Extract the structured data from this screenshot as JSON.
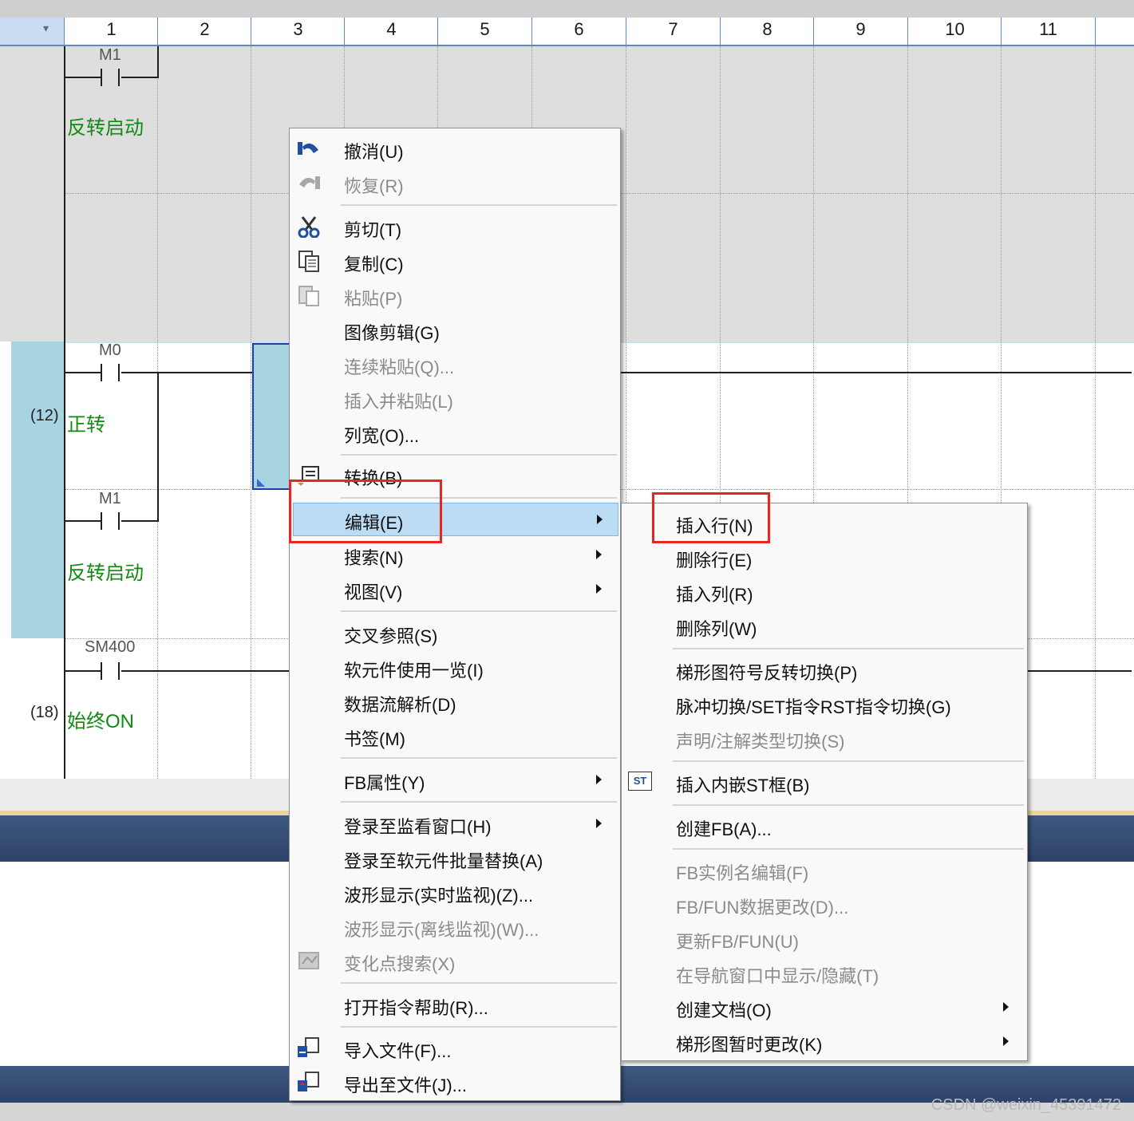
{
  "header": {
    "corner_icon": "chevron-down-icon",
    "corner_glyph": "▾",
    "columns": [
      "1",
      "2",
      "3",
      "4",
      "5",
      "6",
      "7",
      "8",
      "9",
      "10",
      "11"
    ]
  },
  "ladder": {
    "rungs": [
      {
        "step": "",
        "device": "M1",
        "comment": "反转启动"
      },
      {
        "step": "(12)",
        "device": "M0",
        "comment": "正转"
      },
      {
        "step": "",
        "device": "M1",
        "comment": "反转启动"
      },
      {
        "step": "(18)",
        "device": "SM400",
        "comment": "始终ON"
      }
    ]
  },
  "context_menu": {
    "items": [
      {
        "label": "撤消(U)",
        "icon": "undo-icon",
        "disabled": false
      },
      {
        "label": "恢复(R)",
        "icon": "redo-icon",
        "disabled": true
      },
      {
        "label": "剪切(T)",
        "icon": "scissors-icon",
        "disabled": false
      },
      {
        "label": "复制(C)",
        "icon": "copy-icon",
        "disabled": false
      },
      {
        "label": "粘贴(P)",
        "icon": "paste-icon",
        "disabled": true
      },
      {
        "label": "图像剪辑(G)",
        "disabled": false
      },
      {
        "label": "连续粘贴(Q)...",
        "disabled": true
      },
      {
        "label": "插入并粘贴(L)",
        "disabled": true
      },
      {
        "label": "列宽(O)...",
        "disabled": false
      },
      {
        "label": "转换(B)",
        "icon": "convert-icon",
        "disabled": false
      },
      {
        "label": "编辑(E)",
        "submenu": true,
        "active": true
      },
      {
        "label": "搜索(N)",
        "submenu": true
      },
      {
        "label": "视图(V)",
        "submenu": true
      },
      {
        "label": "交叉参照(S)"
      },
      {
        "label": "软元件使用一览(I)"
      },
      {
        "label": "数据流解析(D)"
      },
      {
        "label": "书签(M)"
      },
      {
        "label": "FB属性(Y)",
        "submenu": true
      },
      {
        "label": "登录至监看窗口(H)",
        "submenu": true
      },
      {
        "label": "登录至软元件批量替换(A)"
      },
      {
        "label": "波形显示(实时监视)(Z)..."
      },
      {
        "label": "波形显示(离线监视)(W)...",
        "disabled": true
      },
      {
        "label": "变化点搜索(X)",
        "icon": "change-point-icon",
        "disabled": true
      },
      {
        "label": "打开指令帮助(R)..."
      },
      {
        "label": "导入文件(F)...",
        "icon": "import-file-icon"
      },
      {
        "label": "导出至文件(J)...",
        "icon": "export-file-icon"
      }
    ]
  },
  "submenu": {
    "items": [
      {
        "label": "插入行(N)"
      },
      {
        "label": "删除行(E)"
      },
      {
        "label": "插入列(R)"
      },
      {
        "label": "删除列(W)"
      },
      {
        "label": "梯形图符号反转切换(P)"
      },
      {
        "label": "脉冲切换/SET指令RST指令切换(G)"
      },
      {
        "label": "声明/注解类型切换(S)",
        "disabled": true
      },
      {
        "label": "插入内嵌ST框(B)",
        "icon": "st-box-icon",
        "icon_text": "ST"
      },
      {
        "label": "创建FB(A)..."
      },
      {
        "label": "FB实例名编辑(F)",
        "disabled": true
      },
      {
        "label": "FB/FUN数据更改(D)...",
        "disabled": true
      },
      {
        "label": "更新FB/FUN(U)",
        "disabled": true
      },
      {
        "label": "在导航窗口中显示/隐藏(T)",
        "disabled": true
      },
      {
        "label": "创建文档(O)",
        "submenu": true
      },
      {
        "label": "梯形图暂时更改(K)",
        "submenu": true
      }
    ]
  },
  "colors": {
    "highlight_box": "#e8251e",
    "comment_green": "#118a11",
    "menu_active": "#bcdcf4"
  },
  "watermark": "CSDN @weixin_45391472"
}
